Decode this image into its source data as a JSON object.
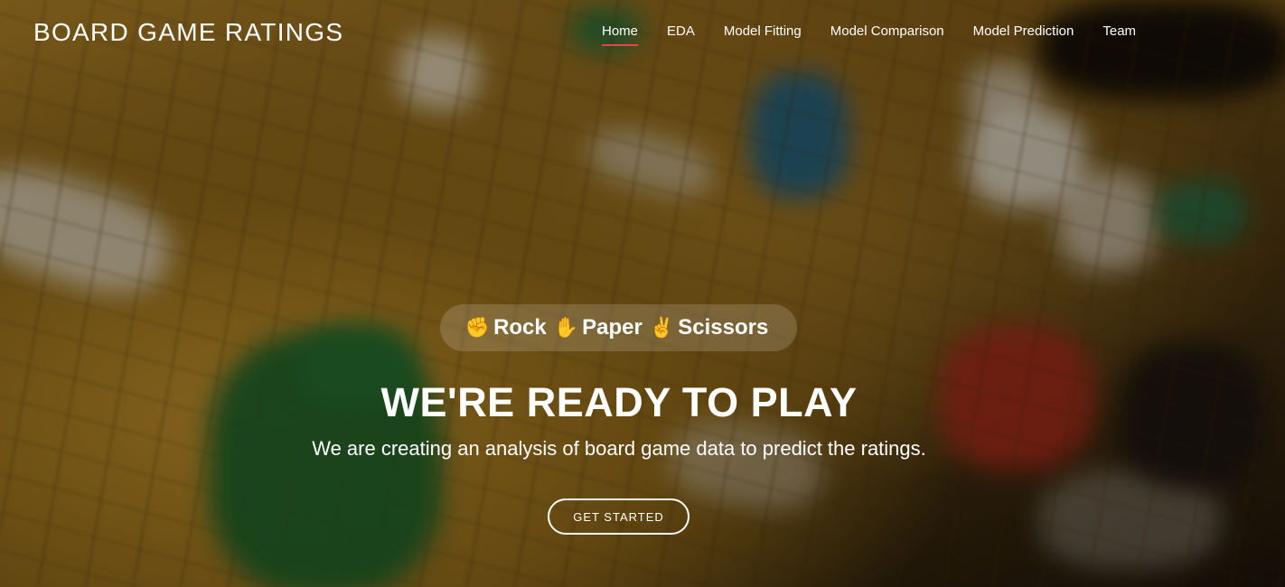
{
  "header": {
    "logo": "BOARD GAME RATINGS",
    "nav": [
      {
        "label": "Home",
        "active": true
      },
      {
        "label": "EDA",
        "active": false
      },
      {
        "label": "Model Fitting",
        "active": false
      },
      {
        "label": "Model Comparison",
        "active": false
      },
      {
        "label": "Model Prediction",
        "active": false
      },
      {
        "label": "Team",
        "active": false
      }
    ],
    "active_underline_color": "#e2454b"
  },
  "hero": {
    "tagline": [
      {
        "icon": "hand-rock-icon",
        "label": "Rock"
      },
      {
        "icon": "hand-paper-icon",
        "label": "Paper"
      },
      {
        "icon": "hand-scissors-icon",
        "label": "Scissors"
      }
    ],
    "title": "WE'RE READY TO PLAY",
    "subtitle": "We are creating an analysis of board game data to predict the ratings.",
    "cta_label": "GET STARTED",
    "background": "blurred-board-game-photo"
  }
}
